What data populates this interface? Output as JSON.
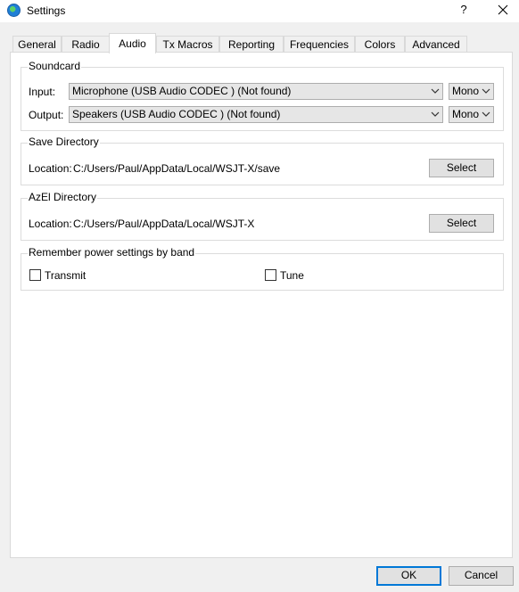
{
  "window": {
    "title": "Settings",
    "help_label": "?"
  },
  "tabs": [
    {
      "label": "General",
      "active": false
    },
    {
      "label": "Radio",
      "active": false
    },
    {
      "label": "Audio",
      "active": true
    },
    {
      "label": "Tx Macros",
      "active": false
    },
    {
      "label": "Reporting",
      "active": false
    },
    {
      "label": "Frequencies",
      "active": false
    },
    {
      "label": "Colors",
      "active": false
    },
    {
      "label": "Advanced",
      "active": false
    }
  ],
  "soundcard": {
    "title": "Soundcard",
    "input_label": "Input:",
    "input_device": "Microphone (USB Audio CODEC ) (Not found)",
    "input_channel": "Mono",
    "output_label": "Output:",
    "output_device": "Speakers (USB Audio CODEC ) (Not found)",
    "output_channel": "Mono"
  },
  "save_directory": {
    "title": "Save Directory",
    "location_label": "Location:",
    "path": "C:/Users/Paul/AppData/Local/WSJT-X/save",
    "select_label": "Select"
  },
  "azel_directory": {
    "title": "AzEl Directory",
    "location_label": "Location:",
    "path": "C:/Users/Paul/AppData/Local/WSJT-X",
    "select_label": "Select"
  },
  "power_settings": {
    "title": "Remember power settings by band",
    "transmit_label": "Transmit",
    "transmit_checked": false,
    "tune_label": "Tune",
    "tune_checked": false
  },
  "footer": {
    "ok_label": "OK",
    "cancel_label": "Cancel"
  }
}
